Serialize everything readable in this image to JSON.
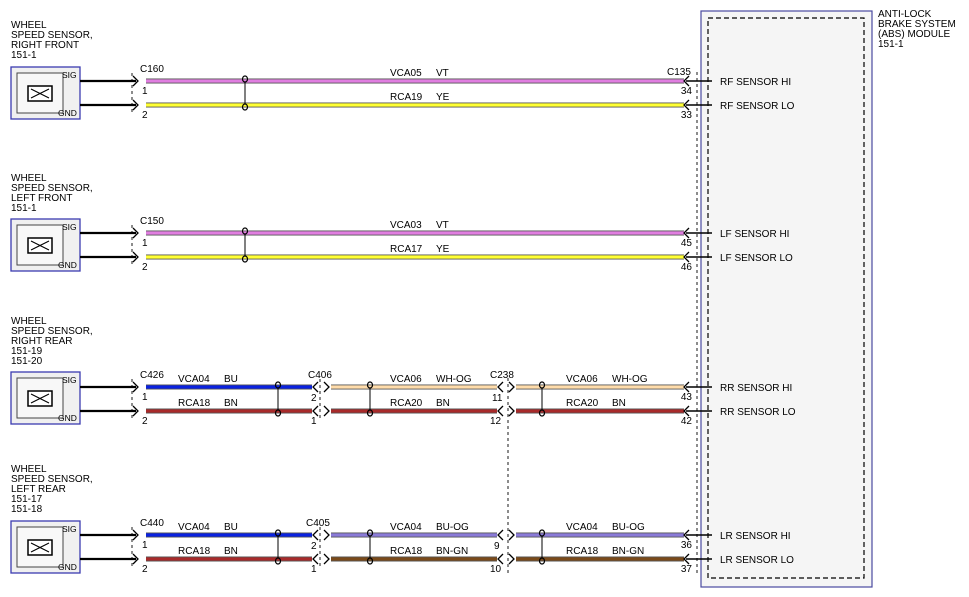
{
  "module": {
    "title_lines": [
      "ANTI-LOCK",
      "BRAKE SYSTEM",
      "(ABS) MODULE",
      "151-1"
    ],
    "pins": [
      {
        "label": "RF SENSOR HI",
        "num": "34"
      },
      {
        "label": "RF SENSOR LO",
        "num": "33"
      },
      {
        "label": "LF SENSOR HI",
        "num": "45"
      },
      {
        "label": "LF SENSOR LO",
        "num": "46"
      },
      {
        "label": "RR SENSOR HI",
        "num": "43"
      },
      {
        "label": "RR SENSOR LO",
        "num": "42"
      },
      {
        "label": "LR SENSOR HI",
        "num": "36"
      },
      {
        "label": "LR SENSOR LO",
        "num": "37"
      }
    ],
    "connector": "C135"
  },
  "sensors": [
    {
      "title_lines": [
        "WHEEL",
        "SPEED SENSOR,",
        "RIGHT FRONT",
        "151-1"
      ],
      "sig": "SIG",
      "gnd": "GND"
    },
    {
      "title_lines": [
        "WHEEL",
        "SPEED SENSOR,",
        "LEFT FRONT",
        "151-1"
      ],
      "sig": "SIG",
      "gnd": "GND"
    },
    {
      "title_lines": [
        "WHEEL",
        "SPEED SENSOR,",
        "RIGHT REAR",
        "151-19",
        "151-20"
      ],
      "sig": "SIG",
      "gnd": "GND"
    },
    {
      "title_lines": [
        "WHEEL",
        "SPEED SENSOR,",
        "LEFT REAR",
        "151-17",
        "151-18"
      ],
      "sig": "SIG",
      "gnd": "GND"
    }
  ],
  "sensor_connectors": [
    {
      "name": "C160",
      "hi_pin": "1",
      "lo_pin": "2"
    },
    {
      "name": "C150",
      "hi_pin": "1",
      "lo_pin": "2"
    },
    {
      "name": "C426",
      "hi_pin": "1",
      "lo_pin": "2"
    },
    {
      "name": "C440",
      "hi_pin": "1",
      "lo_pin": "2"
    }
  ],
  "inline_connectors": [
    {
      "name": "C406",
      "hi_pin": "2",
      "lo_pin": "1"
    },
    {
      "name": "C238",
      "hi_pin": "11",
      "lo_pin": "12"
    },
    {
      "name": "C405",
      "hi_pin": "2",
      "lo_pin": "1"
    },
    {
      "name": "",
      "hi_pin": "9",
      "lo_pin": "10"
    }
  ],
  "wires": {
    "rf_hi": {
      "circuit": "VCA05",
      "color_code": "VT",
      "color": "#e07ee0"
    },
    "rf_lo": {
      "circuit": "RCA19",
      "color_code": "YE",
      "color": "#ffff33"
    },
    "lf_hi": {
      "circuit": "VCA03",
      "color_code": "VT",
      "color": "#e07ee0"
    },
    "lf_lo": {
      "circuit": "RCA17",
      "color_code": "YE",
      "color": "#ffff33"
    },
    "rr_hi_1": {
      "circuit": "VCA04",
      "color_code": "BU",
      "color": "#0a22e0"
    },
    "rr_lo_1": {
      "circuit": "RCA18",
      "color_code": "BN",
      "color": "#a82a2a"
    },
    "rr_hi_2": {
      "circuit": "VCA06",
      "color_code": "WH-OG",
      "color": "#ffdcaa"
    },
    "rr_lo_2": {
      "circuit": "RCA20",
      "color_code": "BN",
      "color": "#a82a2a"
    },
    "rr_hi_3": {
      "circuit": "VCA06",
      "color_code": "WH-OG",
      "color": "#ffdcaa"
    },
    "rr_lo_3": {
      "circuit": "RCA20",
      "color_code": "BN",
      "color": "#a82a2a"
    },
    "lr_hi_1": {
      "circuit": "VCA04",
      "color_code": "BU",
      "color": "#0a22e0"
    },
    "lr_lo_1": {
      "circuit": "RCA18",
      "color_code": "BN",
      "color": "#a82a2a"
    },
    "lr_hi_2": {
      "circuit": "VCA04",
      "color_code": "BU-OG",
      "color": "#8a7ad8"
    },
    "lr_lo_2": {
      "circuit": "RCA18",
      "color_code": "BN-GN",
      "color": "#7a4a1a"
    },
    "lr_hi_3": {
      "circuit": "VCA04",
      "color_code": "BU-OG",
      "color": "#8a7ad8"
    },
    "lr_lo_3": {
      "circuit": "RCA18",
      "color_code": "BN-GN",
      "color": "#7a4a1a"
    }
  }
}
